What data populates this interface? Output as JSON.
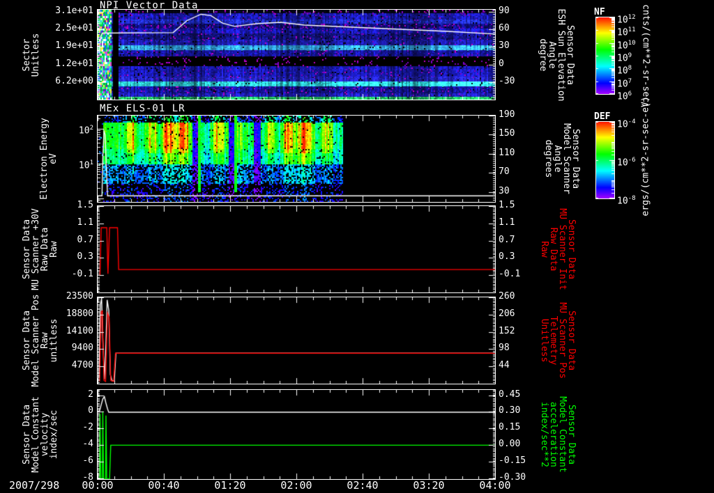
{
  "page": {
    "background": "#000000",
    "foreground": "#ffffff"
  },
  "footer": {
    "date": "2007/298",
    "time_ticks": [
      "00:00",
      "00:40",
      "01:20",
      "02:00",
      "02:40",
      "03:20",
      "04:00"
    ]
  },
  "colorbars": [
    {
      "title": "NF",
      "unit": "cnts/(cm**2-sr-sec)",
      "tick_labels": [
        "10^12",
        "10^11",
        "10^10",
        "10^9",
        "10^8",
        "10^7",
        "10^6"
      ],
      "tick_fracs": [
        0,
        0.1667,
        0.3333,
        0.5,
        0.6667,
        0.8333,
        1
      ],
      "decades": 6
    },
    {
      "title": "DEF",
      "unit": "ergs/(cm**2-sr-sec-eV)",
      "tick_labels": [
        "10^-4",
        "10^-6",
        "10^-8"
      ],
      "tick_fracs": [
        0,
        0.5,
        1
      ],
      "decades": 4
    }
  ],
  "chart_data": [
    {
      "id": "npi",
      "type": "heatmap",
      "title": "NPI Vector Data",
      "left_label": [
        "Sector",
        "Unitless"
      ],
      "left_ticks": [
        {
          "f": 0.025,
          "t": "3.1e+01"
        },
        {
          "f": 0.22,
          "t": "2.5e+01"
        },
        {
          "f": 0.41,
          "t": "1.9e+01"
        },
        {
          "f": 0.61,
          "t": "1.2e+01"
        },
        {
          "f": 0.805,
          "t": "6.2e+00"
        }
      ],
      "right_ticks": [
        {
          "f": 0.025,
          "t": "90"
        },
        {
          "f": 0.22,
          "t": "60"
        },
        {
          "f": 0.41,
          "t": "30"
        },
        {
          "f": 0.61,
          "t": "0"
        },
        {
          "f": 0.805,
          "t": "-30"
        }
      ],
      "right_label": [
        "Sensor Data",
        "ESH Sun Elevation",
        "Angle",
        "degree"
      ],
      "right_label_color": "#ffffff",
      "seed": 42,
      "strip": [
        0.0,
        0.034
      ],
      "gap": [
        0.036,
        0.052
      ],
      "palette": [
        "#00d84a",
        "#55ff99",
        "#ffffff",
        "#29ccff",
        "#e040e0",
        "#ffe642",
        "#2255ff",
        "#00a344",
        "#7a00c8"
      ],
      "rows": [
        [
          0.0,
          0.045,
          "#05051a",
          0.5,
          0.1,
          0
        ],
        [
          0.045,
          0.115,
          "#1e1ecf",
          0.35,
          0.04,
          0
        ],
        [
          0.115,
          0.16,
          "#2535ee",
          0.3,
          0.02,
          0
        ],
        [
          0.16,
          0.21,
          "#11118f",
          0.45,
          0.12,
          0
        ],
        [
          0.21,
          0.27,
          "#1d1dd8",
          0.3,
          0.03,
          0
        ],
        [
          0.27,
          0.335,
          "#17179b",
          0.4,
          0.05,
          0
        ],
        [
          0.335,
          0.4,
          "#2121ca",
          0.3,
          0.03,
          0
        ],
        [
          0.4,
          0.455,
          "#38b6f8",
          0.22,
          0.0,
          0.15
        ],
        [
          0.455,
          0.52,
          "#1a1abc",
          0.32,
          0.04,
          0
        ],
        [
          0.52,
          0.635,
          "#000000",
          0.0,
          0.08,
          0
        ],
        [
          0.635,
          0.75,
          "#1e1ed2",
          0.3,
          0.04,
          0
        ],
        [
          0.75,
          0.8,
          "#2b2be6",
          0.28,
          0.02,
          0
        ],
        [
          0.8,
          0.86,
          "#2ed2d8",
          0.25,
          0.0,
          0.55
        ],
        [
          0.86,
          0.935,
          "#1818b2",
          0.38,
          0.06,
          0
        ],
        [
          0.935,
          0.975,
          "#2424da",
          0.3,
          0.03,
          0
        ],
        [
          0.975,
          1.0,
          "#2ad870",
          0.3,
          0.0,
          0.2
        ]
      ],
      "overlay": {
        "color": "#ffffff",
        "pts": [
          [
            0.004,
            0.47
          ],
          [
            0.008,
            0.3
          ],
          [
            0.012,
            0.26
          ],
          [
            0.19,
            0.255
          ],
          [
            0.225,
            0.12
          ],
          [
            0.26,
            0.05
          ],
          [
            0.285,
            0.065
          ],
          [
            0.315,
            0.15
          ],
          [
            0.345,
            0.185
          ],
          [
            0.4,
            0.155
          ],
          [
            0.46,
            0.14
          ],
          [
            0.52,
            0.17
          ],
          [
            0.62,
            0.19
          ],
          [
            0.75,
            0.215
          ],
          [
            0.88,
            0.24
          ],
          [
            1.0,
            0.27
          ]
        ]
      }
    },
    {
      "id": "els",
      "type": "heatmap",
      "title": "MEx ELS-01 LR",
      "left_label": [
        "Electron Energy",
        "eV"
      ],
      "left_ticks": [
        {
          "f": 0.153,
          "t": "10^2"
        },
        {
          "f": 0.556,
          "t": "10^1"
        }
      ],
      "right_ticks": [
        {
          "f": 0.0,
          "t": "190"
        },
        {
          "f": 0.22,
          "t": "150"
        },
        {
          "f": 0.44,
          "t": "110"
        },
        {
          "f": 0.66,
          "t": "70"
        },
        {
          "f": 0.885,
          "t": "30"
        }
      ],
      "right_label": [
        "Sensor Data",
        "Model Scanner",
        "Angle",
        "degrees"
      ],
      "right_label_color": "#ffffff",
      "seed": 1337,
      "els": {
        "active": [
          0.012,
          0.615
        ],
        "blobs": [
          0.085,
          0.135,
          0.175,
          0.215,
          0.3,
          0.435,
          0.475,
          0.52,
          0.575
        ],
        "gaps": [
          0.245,
          0.335,
          0.4
        ],
        "stripes": [
          0.255,
          0.345
        ]
      },
      "overlay": {
        "color": "#ffffff",
        "pts": [
          [
            0.0,
            0.93
          ],
          [
            0.011,
            0.93
          ],
          [
            0.013,
            0.5
          ],
          [
            0.016,
            0.18
          ],
          [
            0.019,
            0.22
          ],
          [
            0.022,
            0.6
          ],
          [
            0.025,
            0.93
          ],
          [
            1.0,
            0.93
          ]
        ]
      }
    },
    {
      "id": "mu30",
      "type": "line",
      "yrange": [
        -0.5,
        1.5
      ],
      "left_label": [
        "Sensor Data",
        "MU Scanner +30V",
        "Raw Data",
        "Raw"
      ],
      "left_ticks": [
        {
          "f": 0.0,
          "t": "1.5"
        },
        {
          "f": 0.2,
          "t": "1.1"
        },
        {
          "f": 0.4,
          "t": "0.7"
        },
        {
          "f": 0.6,
          "t": "0.3"
        },
        {
          "f": 0.8,
          "t": "-0.1"
        }
      ],
      "right_ticks": [
        {
          "f": 0.0,
          "t": "1.5"
        },
        {
          "f": 0.2,
          "t": "1.1"
        },
        {
          "f": 0.4,
          "t": "0.7"
        },
        {
          "f": 0.6,
          "t": "0.3"
        },
        {
          "f": 0.8,
          "t": "-0.1"
        }
      ],
      "right_label": [
        "Sensor Data",
        "MU Scanner Init",
        "Raw Data",
        "Raw"
      ],
      "right_label_color": "#ff0000",
      "series": [
        {
          "color": "#ff0000",
          "pts": [
            [
              0.006,
              -0.1
            ],
            [
              0.009,
              1.0
            ],
            [
              0.023,
              1.0
            ],
            [
              0.026,
              -0.07
            ],
            [
              0.03,
              1.0
            ],
            [
              0.05,
              1.0
            ],
            [
              0.053,
              0.03
            ],
            [
              1.0,
              0.03
            ]
          ]
        }
      ]
    },
    {
      "id": "scanpos",
      "type": "line",
      "yrange": [
        0,
        23500
      ],
      "left_label": [
        "Sensor Data",
        "Model Scanner Pos",
        "Raw",
        "unitless"
      ],
      "left_ticks": [
        {
          "f": 0.0,
          "t": "23500"
        },
        {
          "f": 0.2,
          "t": "18800"
        },
        {
          "f": 0.4,
          "t": "14100"
        },
        {
          "f": 0.6,
          "t": "9400"
        },
        {
          "f": 0.8,
          "t": "4700"
        }
      ],
      "right_ticks": [
        {
          "f": 0.0,
          "t": "260"
        },
        {
          "f": 0.2,
          "t": "206"
        },
        {
          "f": 0.4,
          "t": "152"
        },
        {
          "f": 0.6,
          "t": "98"
        },
        {
          "f": 0.8,
          "t": "44"
        }
      ],
      "right_label": [
        "Sensor Data",
        "MU Scanner Pos",
        "Telemetry",
        "Unitless"
      ],
      "right_label_color": "#ff0000",
      "series": [
        {
          "color": "#ffffff",
          "pts": [
            [
              0.003,
              1500
            ],
            [
              0.007,
              21500
            ],
            [
              0.01,
              23200
            ],
            [
              0.013,
              12000
            ],
            [
              0.017,
              1200
            ],
            [
              0.021,
              11000
            ],
            [
              0.024,
              22800
            ],
            [
              0.028,
              20000
            ],
            [
              0.032,
              2500
            ],
            [
              0.036,
              800
            ],
            [
              0.042,
              800
            ],
            [
              0.046,
              8300
            ],
            [
              1.0,
              8300
            ]
          ]
        },
        {
          "color": "#ff0000",
          "pts": [
            [
              0.005,
              600
            ],
            [
              0.009,
              19500
            ],
            [
              0.012,
              19800
            ],
            [
              0.016,
              900
            ],
            [
              0.02,
              600
            ],
            [
              0.025,
              19200
            ],
            [
              0.029,
              18000
            ],
            [
              0.033,
              900
            ],
            [
              0.04,
              600
            ],
            [
              0.045,
              8300
            ],
            [
              1.0,
              8300
            ]
          ]
        }
      ]
    },
    {
      "id": "modconst",
      "type": "line",
      "yrange": [
        -8.1,
        2.7
      ],
      "left_label": [
        "Sensor Data",
        "Model Constant",
        "velocity",
        "index/sec"
      ],
      "left_ticks": [
        {
          "f": 0.06,
          "t": "2"
        },
        {
          "f": 0.246,
          "t": "0"
        },
        {
          "f": 0.432,
          "t": "-2"
        },
        {
          "f": 0.618,
          "t": "-4"
        },
        {
          "f": 0.804,
          "t": "-6"
        },
        {
          "f": 0.99,
          "t": "-8"
        }
      ],
      "right_ticks": [
        {
          "f": 0.06,
          "t": "0.45"
        },
        {
          "f": 0.246,
          "t": "0.30"
        },
        {
          "f": 0.432,
          "t": "0.15"
        },
        {
          "f": 0.618,
          "t": "0.00"
        },
        {
          "f": 0.804,
          "t": "-0.15"
        },
        {
          "f": 0.99,
          "t": "-0.30"
        }
      ],
      "right_label": [
        "Sensor Data",
        "Model Constant",
        "acceleration",
        "index/sec**2"
      ],
      "right_label_color": "#00ff00",
      "series": [
        {
          "color": "#ffffff",
          "pts": [
            [
              0.004,
              0
            ],
            [
              0.009,
              0.9
            ],
            [
              0.013,
              1.6
            ],
            [
              0.017,
              1.9
            ],
            [
              0.021,
              1.1
            ],
            [
              0.025,
              0.4
            ],
            [
              0.028,
              0
            ],
            [
              1.0,
              0
            ]
          ]
        },
        {
          "color": "#00ff00",
          "pts": [
            [
              0.005,
              -8.1
            ],
            [
              0.006,
              -0.2
            ],
            [
              0.008,
              -8.1
            ],
            [
              0.012,
              -8.1
            ],
            [
              0.013,
              0.1
            ],
            [
              0.015,
              -8.1
            ],
            [
              0.02,
              -8.1
            ],
            [
              0.021,
              -0.4
            ],
            [
              0.023,
              -8.1
            ],
            [
              0.03,
              -8.1
            ],
            [
              0.033,
              -4.0
            ],
            [
              1.0,
              -4.0
            ]
          ]
        }
      ]
    }
  ]
}
